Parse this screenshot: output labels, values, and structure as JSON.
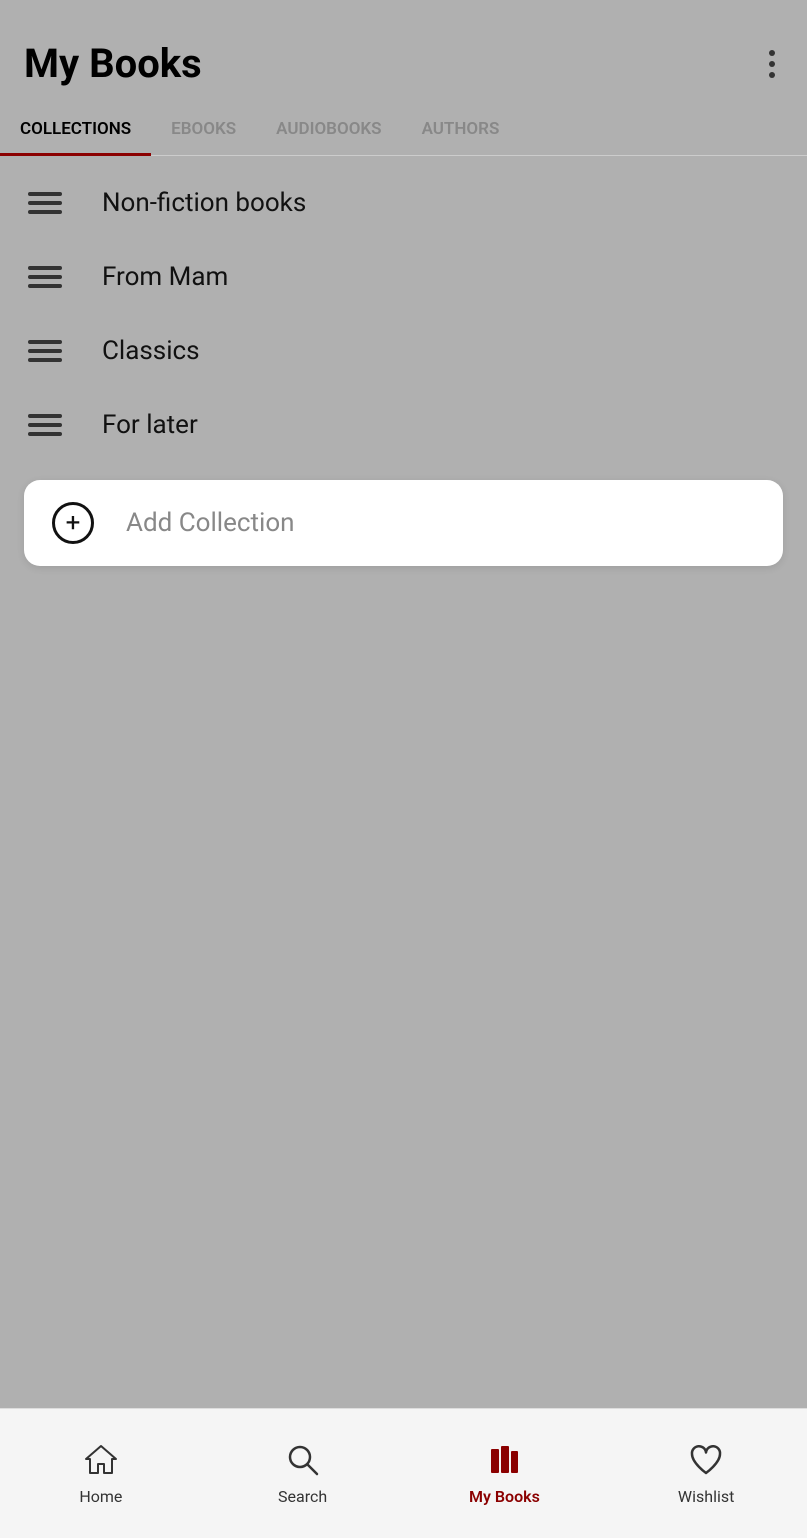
{
  "header": {
    "title": "My Books",
    "menu_icon_label": "more-options"
  },
  "tabs": [
    {
      "id": "collections",
      "label": "COLLECTIONS",
      "active": true
    },
    {
      "id": "ebooks",
      "label": "EBOOKS",
      "active": false
    },
    {
      "id": "audiobooks",
      "label": "AUDIOBOOKS",
      "active": false
    },
    {
      "id": "authors",
      "label": "AUTHORS",
      "active": false
    }
  ],
  "collections": [
    {
      "id": 1,
      "name": "Non-fiction books"
    },
    {
      "id": 2,
      "name": "From Mam"
    },
    {
      "id": 3,
      "name": "Classics"
    },
    {
      "id": 4,
      "name": "For later"
    }
  ],
  "add_collection": {
    "label": "Add Collection"
  },
  "bottom_nav": [
    {
      "id": "home",
      "label": "Home",
      "active": false
    },
    {
      "id": "search",
      "label": "Search",
      "active": false
    },
    {
      "id": "mybooks",
      "label": "My Books",
      "active": true
    },
    {
      "id": "wishlist",
      "label": "Wishlist",
      "active": false
    }
  ],
  "colors": {
    "accent": "#8B0000",
    "active_tab_underline": "#8B0000",
    "background": "#b0b0b0"
  }
}
